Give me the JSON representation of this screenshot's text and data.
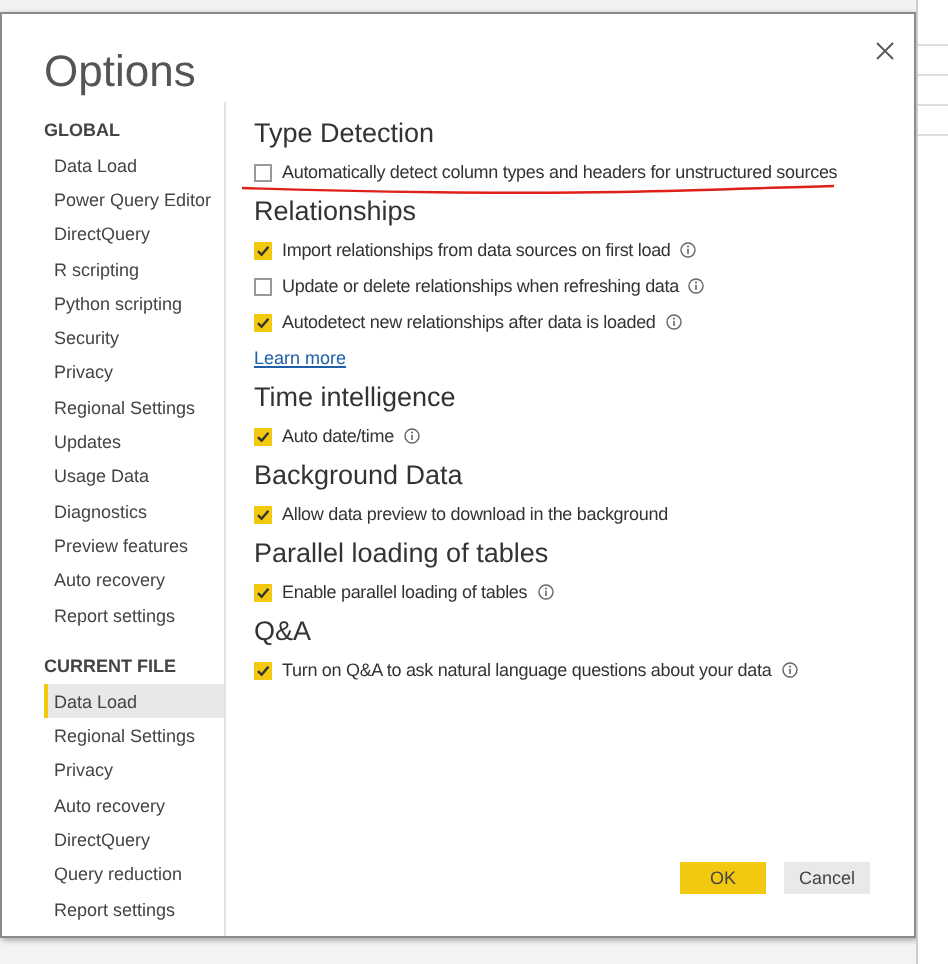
{
  "window": {
    "title": "Options"
  },
  "sidebar": {
    "sections": [
      {
        "heading": "GLOBAL",
        "items": [
          {
            "label": "Data Load",
            "selected": false
          },
          {
            "label": "Power Query Editor",
            "selected": false
          },
          {
            "label": "DirectQuery",
            "selected": false
          },
          {
            "label": "R scripting",
            "selected": false
          },
          {
            "label": "Python scripting",
            "selected": false
          },
          {
            "label": "Security",
            "selected": false
          },
          {
            "label": "Privacy",
            "selected": false
          },
          {
            "label": "Regional Settings",
            "selected": false
          },
          {
            "label": "Updates",
            "selected": false
          },
          {
            "label": "Usage Data",
            "selected": false
          },
          {
            "label": "Diagnostics",
            "selected": false
          },
          {
            "label": "Preview features",
            "selected": false
          },
          {
            "label": "Auto recovery",
            "selected": false
          },
          {
            "label": "Report settings",
            "selected": false
          }
        ]
      },
      {
        "heading": "CURRENT FILE",
        "items": [
          {
            "label": "Data Load",
            "selected": true
          },
          {
            "label": "Regional Settings",
            "selected": false
          },
          {
            "label": "Privacy",
            "selected": false
          },
          {
            "label": "Auto recovery",
            "selected": false
          },
          {
            "label": "DirectQuery",
            "selected": false
          },
          {
            "label": "Query reduction",
            "selected": false
          },
          {
            "label": "Report settings",
            "selected": false
          }
        ]
      }
    ]
  },
  "content": {
    "sections": [
      {
        "heading": "Type Detection",
        "items": [
          {
            "kind": "checkbox",
            "label": "Automatically detect column types and headers for unstructured sources",
            "checked": false,
            "info": false,
            "underlined": true
          }
        ]
      },
      {
        "heading": "Relationships",
        "items": [
          {
            "kind": "checkbox",
            "label": "Import relationships from data sources on first load",
            "checked": true,
            "info": true
          },
          {
            "kind": "checkbox",
            "label": "Update or delete relationships when refreshing data",
            "checked": false,
            "info": true
          },
          {
            "kind": "checkbox",
            "label": "Autodetect new relationships after data is loaded",
            "checked": true,
            "info": true
          },
          {
            "kind": "link",
            "label": "Learn more"
          }
        ]
      },
      {
        "heading": "Time intelligence",
        "items": [
          {
            "kind": "checkbox",
            "label": "Auto date/time",
            "checked": true,
            "info": true
          }
        ]
      },
      {
        "heading": "Background Data",
        "items": [
          {
            "kind": "checkbox",
            "label": "Allow data preview to download in the background",
            "checked": true,
            "info": false
          }
        ]
      },
      {
        "heading": "Parallel loading of tables",
        "items": [
          {
            "kind": "checkbox",
            "label": "Enable parallel loading of tables",
            "checked": true,
            "info": true
          }
        ]
      },
      {
        "heading": "Q&A",
        "items": [
          {
            "kind": "checkbox",
            "label": "Turn on Q&A to ask natural language questions about your data",
            "checked": true,
            "info": true
          }
        ]
      }
    ]
  },
  "buttons": [
    {
      "label": "OK",
      "kind": "primary"
    },
    {
      "label": "Cancel",
      "kind": "secondary"
    }
  ]
}
